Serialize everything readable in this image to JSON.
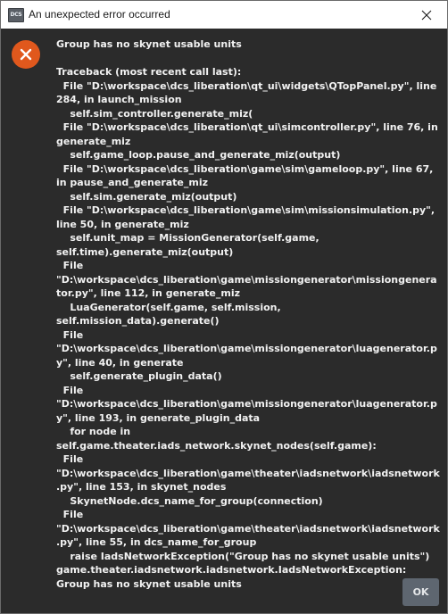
{
  "window": {
    "title": "An unexpected error occurred",
    "app_icon_text": "DCS",
    "close_icon": "close-icon"
  },
  "dialog": {
    "icon": "error-icon",
    "icon_color": "#e0581d",
    "headline": "Group has no skynet usable units",
    "traceback": "Traceback (most recent call last):\n  File \"D:\\workspace\\dcs_liberation\\qt_ui\\widgets\\QTopPanel.py\", line 284, in launch_mission\n    self.sim_controller.generate_miz(\n  File \"D:\\workspace\\dcs_liberation\\qt_ui\\simcontroller.py\", line 76, in generate_miz\n    self.game_loop.pause_and_generate_miz(output)\n  File \"D:\\workspace\\dcs_liberation\\game\\sim\\gameloop.py\", line 67, in pause_and_generate_miz\n    self.sim.generate_miz(output)\n  File \"D:\\workspace\\dcs_liberation\\game\\sim\\missionsimulation.py\", line 50, in generate_miz\n    self.unit_map = MissionGenerator(self.game, self.time).generate_miz(output)\n  File \"D:\\workspace\\dcs_liberation\\game\\missiongenerator\\missiongenerator.py\", line 112, in generate_miz\n    LuaGenerator(self.game, self.mission, self.mission_data).generate()\n  File \"D:\\workspace\\dcs_liberation\\game\\missiongenerator\\luagenerator.py\", line 40, in generate\n    self.generate_plugin_data()\n  File \"D:\\workspace\\dcs_liberation\\game\\missiongenerator\\luagenerator.py\", line 193, in generate_plugin_data\n    for node in self.game.theater.iads_network.skynet_nodes(self.game):\n  File \"D:\\workspace\\dcs_liberation\\game\\theater\\iadsnetwork\\iadsnetwork.py\", line 153, in skynet_nodes\n    SkynetNode.dcs_name_for_group(connection)\n  File \"D:\\workspace\\dcs_liberation\\game\\theater\\iadsnetwork\\iadsnetwork.py\", line 55, in dcs_name_for_group\n    raise IadsNetworkException(\"Group has no skynet usable units\")\ngame.theater.iadsnetwork.iadsnetwork.IadsNetworkException: Group has no skynet usable units"
  },
  "buttons": {
    "ok_label": "OK"
  },
  "colors": {
    "dialog_background": "#2b2b2b",
    "text": "#f2f2f2",
    "button_background": "#5e6670"
  }
}
